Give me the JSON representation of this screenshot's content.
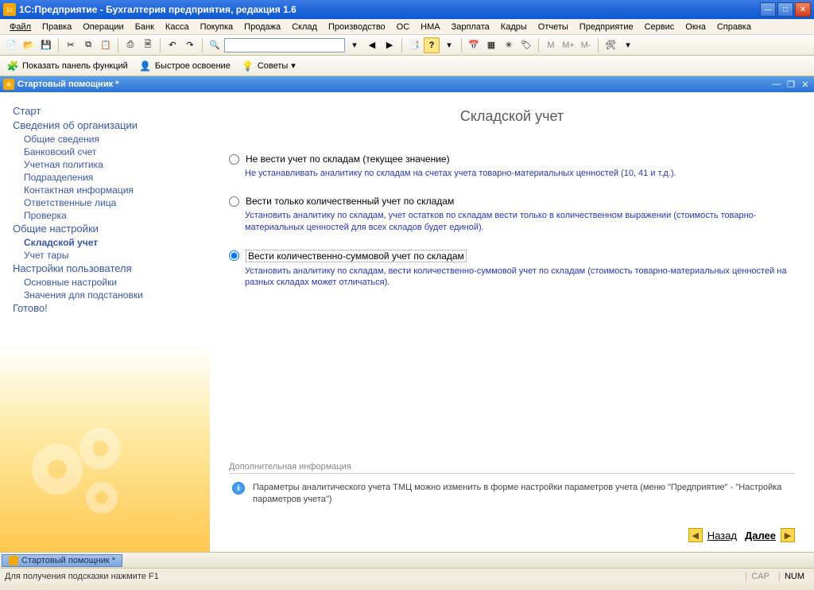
{
  "window": {
    "title": "1С:Предприятие - Бухгалтерия предприятия, редакция 1.6"
  },
  "menu": [
    "Файл",
    "Правка",
    "Операции",
    "Банк",
    "Касса",
    "Покупка",
    "Продажа",
    "Склад",
    "Производство",
    "ОС",
    "НМА",
    "Зарплата",
    "Кадры",
    "Отчеты",
    "Предприятие",
    "Сервис",
    "Окна",
    "Справка"
  ],
  "toolbar1": {
    "search_placeholder": "",
    "m": "M",
    "mplus": "M+",
    "mminus": "M-"
  },
  "toolbar2": {
    "show_panel": "Показать панель функций",
    "quick_start": "Быстрое освоение",
    "tips": "Советы"
  },
  "subwindow": {
    "title": "Стартовый помощник *"
  },
  "nav": {
    "g1": "Старт",
    "g2": "Сведения об организации",
    "g2items": [
      "Общие сведения",
      "Банковский счет",
      "Учетная политика",
      "Подразделения",
      "Контактная информация",
      "Ответственные лица",
      "Проверка"
    ],
    "g3": "Общие настройки",
    "g3items": [
      "Складской учет",
      "Учет тары"
    ],
    "g4": "Настройки пользователя",
    "g4items": [
      "Основные настройки",
      "Значения для подстановки"
    ],
    "g5": "Готово!"
  },
  "page": {
    "title": "Складской учет",
    "opt1": {
      "label": "Не вести учет по складам (текущее значение)",
      "desc": "Не устанавливать аналитику по складам  на счетах учета товарно-материальных ценностей (10, 41 и т.д.)."
    },
    "opt2": {
      "label": "Вести только количественный учет по складам",
      "desc": "Установить аналитику по складам, учет остатков по складам вести только в количественном выражении (стоимость товарно-материальных ценностей для всех складов будет единой)."
    },
    "opt3": {
      "label": "Вести количественно-суммовой учет по складам",
      "desc": "Установить аналитику по складам, вести количественно-суммовой учет по складам (стоимость товарно-материальных ценностей на разных складах может отличаться)."
    },
    "addinfo_title": "Дополнительная информация",
    "addinfo_text": "Параметры аналитического учета ТМЦ можно изменить в форме настройки параметров учета (меню \"Предприятие\" - \"Настройка параметров учета\")",
    "back": "Назад",
    "next": "Далее"
  },
  "taskbar": {
    "tab": "Стартовый помощник *"
  },
  "status": {
    "hint": "Для получения подсказки нажмите F1",
    "cap": "CAP",
    "num": "NUM"
  }
}
